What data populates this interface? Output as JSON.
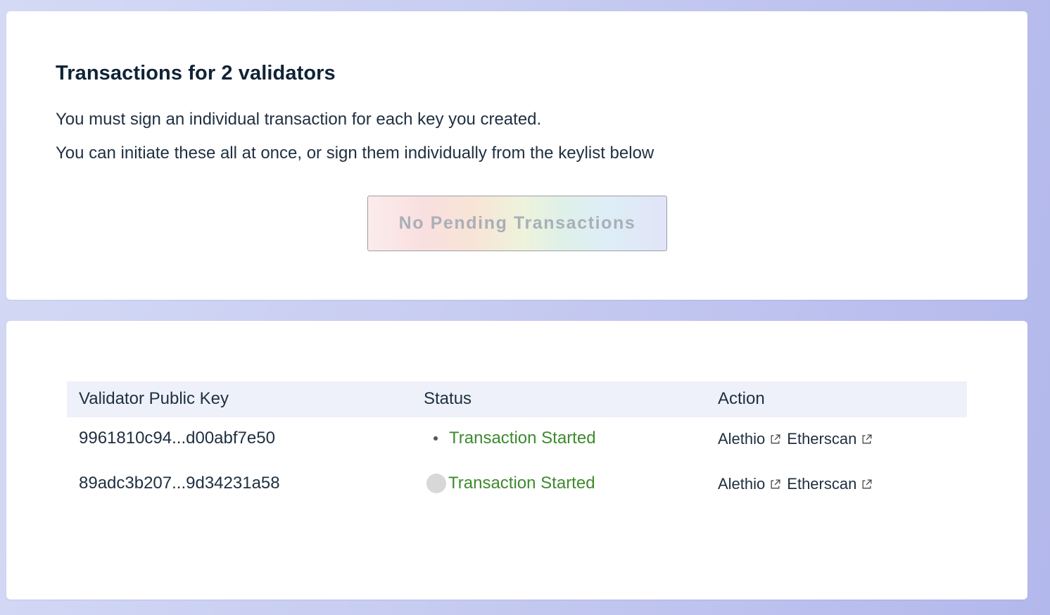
{
  "transactions_card": {
    "heading": "Transactions for 2 validators",
    "line_1": "You must sign an individual transaction for each key you created.",
    "line_2": "You can initiate these all at once, or sign them individually from the keylist below",
    "button_label": "No Pending Transactions"
  },
  "keylist": {
    "columns": {
      "key": "Validator Public Key",
      "status": "Status",
      "action": "Action"
    },
    "rows": [
      {
        "public_key": "9961810c94...d00abf7e50",
        "status": "Transaction Started",
        "link_1": "Alethio",
        "link_2": "Etherscan"
      },
      {
        "public_key": "89adc3b207...9d34231a58",
        "status": "Transaction Started",
        "link_1": "Alethio",
        "link_2": "Etherscan"
      }
    ]
  },
  "colors": {
    "status_green": "#3e8a2e",
    "header_row_bg": "#eef1fa"
  }
}
